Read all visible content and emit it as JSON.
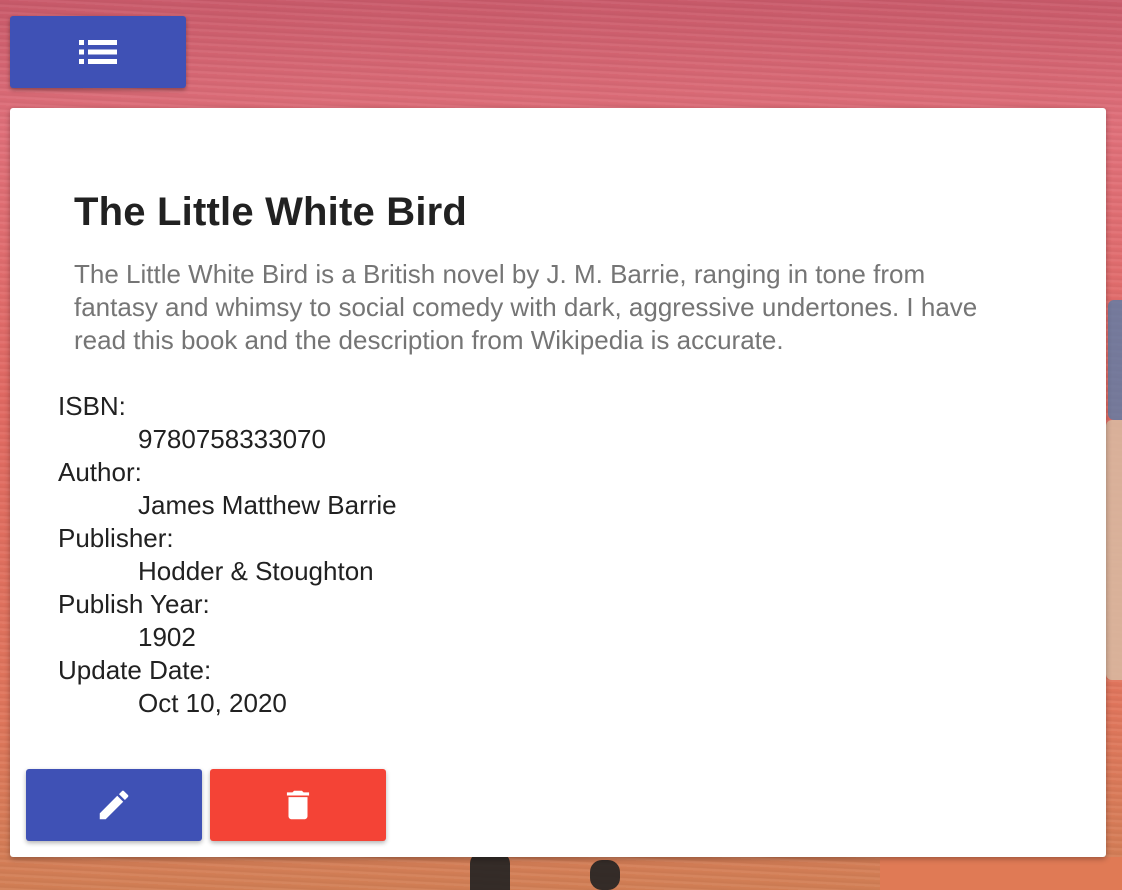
{
  "toolbar": {
    "menu_icon": "list-icon"
  },
  "book": {
    "title": "The Little White Bird",
    "description": "The Little White Bird is a British novel by J. M. Barrie, ranging in tone from fantasy and whimsy to social comedy with dark, aggressive undertones. I have read this book and the description from Wikipedia is accurate.",
    "fields": {
      "isbn": {
        "label": "ISBN:",
        "value": "9780758333070"
      },
      "author": {
        "label": "Author:",
        "value": "James Matthew Barrie"
      },
      "publisher": {
        "label": "Publisher:",
        "value": "Hodder & Stoughton"
      },
      "publish_year": {
        "label": "Publish Year:",
        "value": "1902"
      },
      "update_date": {
        "label": "Update Date:",
        "value": "Oct 10, 2020"
      }
    }
  },
  "actions": {
    "edit_icon": "pencil-icon",
    "delete_icon": "trash-icon"
  },
  "colors": {
    "primary": "#3f51b5",
    "danger": "#f44336",
    "title_text": "#212121",
    "description_text": "#757575"
  }
}
